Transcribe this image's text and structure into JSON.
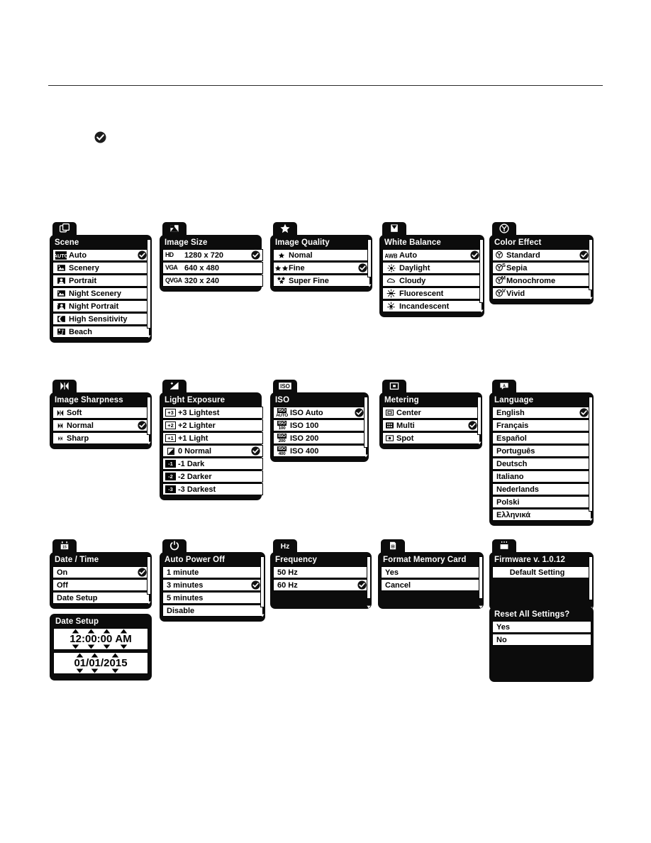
{
  "page": {
    "rule": true,
    "stray_check_icon": "check-circle-icon"
  },
  "menus": [
    {
      "id": "scene",
      "tab_icon": "scene-mode-icon",
      "title": "Scene",
      "scrollbar": true,
      "items": [
        {
          "icon": "auto-badge-icon",
          "label": "Auto",
          "selected": true
        },
        {
          "icon": "scenery-icon",
          "label": "Scenery",
          "selected": false
        },
        {
          "icon": "portrait-icon",
          "label": "Portrait",
          "selected": false
        },
        {
          "icon": "night-scenery-icon",
          "label": "Night Scenery",
          "selected": false
        },
        {
          "icon": "night-portrait-icon",
          "label": "Night Portrait",
          "selected": false
        },
        {
          "icon": "high-sensitivity-icon",
          "label": "High Sensitivity",
          "selected": false
        },
        {
          "icon": "beach-icon",
          "label": "Beach",
          "selected": false
        }
      ]
    },
    {
      "id": "image-size",
      "tab_icon": "image-size-icon",
      "title": "Image Size",
      "scrollbar": false,
      "items": [
        {
          "icon": "hd-badge-icon",
          "label": "1280 x 720",
          "badge": "HD",
          "selected": true
        },
        {
          "icon": "vga-badge-icon",
          "label": "640 x 480",
          "badge": "VGA",
          "selected": false
        },
        {
          "icon": "qvga-badge-icon",
          "label": "320 x 240",
          "badge": "QVGA",
          "selected": false
        }
      ]
    },
    {
      "id": "image-quality",
      "tab_icon": "star-icon",
      "title": "Image Quality",
      "scrollbar": true,
      "items": [
        {
          "icon": "one-star-icon",
          "label": "Nomal",
          "selected": false
        },
        {
          "icon": "two-star-icon",
          "label": "Fine",
          "selected": true
        },
        {
          "icon": "three-star-icon",
          "label": "Super Fine",
          "selected": false
        }
      ]
    },
    {
      "id": "white-balance",
      "tab_icon": "white-balance-icon",
      "title": "White Balance",
      "scrollbar": true,
      "items": [
        {
          "icon": "awb-badge-icon",
          "label": "Auto",
          "selected": true
        },
        {
          "icon": "sun-icon",
          "label": "Daylight",
          "selected": false
        },
        {
          "icon": "cloud-icon",
          "label": "Cloudy",
          "selected": false
        },
        {
          "icon": "fluorescent-icon",
          "label": "Fluorescent",
          "selected": false
        },
        {
          "icon": "incandescent-icon",
          "label": "Incandescent",
          "selected": false
        }
      ]
    },
    {
      "id": "color-effect",
      "tab_icon": "color-effect-icon",
      "title": "Color Effect",
      "scrollbar": true,
      "items": [
        {
          "icon": "color-standard-icon",
          "label": "Standard",
          "selected": true
        },
        {
          "icon": "color-sepia-icon",
          "label": "Sepia",
          "selected": false
        },
        {
          "icon": "color-monochrome-icon",
          "label": "Monochrome",
          "selected": false
        },
        {
          "icon": "color-vivid-icon",
          "label": "Vivid",
          "selected": false
        }
      ]
    },
    {
      "id": "image-sharpness",
      "tab_icon": "sharpness-icon",
      "title": "Image Sharpness",
      "scrollbar": true,
      "items": [
        {
          "icon": "sharp-soft-icon",
          "label": "Soft",
          "selected": false
        },
        {
          "icon": "sharp-normal-icon",
          "label": "Normal",
          "selected": true
        },
        {
          "icon": "sharp-sharp-icon",
          "label": "Sharp",
          "selected": false
        }
      ]
    },
    {
      "id": "light-exposure",
      "tab_icon": "exposure-icon",
      "title": "Light Exposure",
      "scrollbar": false,
      "items": [
        {
          "icon": "ev-plus3-icon",
          "label": "+3 Lightest",
          "badge": "+3",
          "selected": false
        },
        {
          "icon": "ev-plus2-icon",
          "label": "+2 Lighter",
          "badge": "+2",
          "selected": false
        },
        {
          "icon": "ev-plus1-icon",
          "label": "+1 Light",
          "badge": "+1",
          "selected": false
        },
        {
          "icon": "ev-zero-icon",
          "label": "0 Normal",
          "badge": "",
          "selected": true
        },
        {
          "icon": "ev-minus1-icon",
          "label": "-1 Dark",
          "badge": "-1",
          "selected": false
        },
        {
          "icon": "ev-minus2-icon",
          "label": "-2 Darker",
          "badge": "-2",
          "selected": false
        },
        {
          "icon": "ev-minus3-icon",
          "label": "-3 Darkest",
          "badge": "-3",
          "selected": false
        }
      ]
    },
    {
      "id": "iso",
      "tab_icon": "iso-icon",
      "title": "ISO",
      "scrollbar": true,
      "items": [
        {
          "icon": "iso-auto-badge-icon",
          "label": "ISO Auto",
          "badge": "AUTO",
          "selected": true
        },
        {
          "icon": "iso-100-badge-icon",
          "label": "ISO 100",
          "badge": "100",
          "selected": false
        },
        {
          "icon": "iso-200-badge-icon",
          "label": "ISO 200",
          "badge": "200",
          "selected": false
        },
        {
          "icon": "iso-400-badge-icon",
          "label": "ISO 400",
          "badge": "400",
          "selected": false
        }
      ]
    },
    {
      "id": "metering",
      "tab_icon": "metering-icon",
      "title": "Metering",
      "scrollbar": true,
      "items": [
        {
          "icon": "metering-center-icon",
          "label": "Center",
          "selected": false
        },
        {
          "icon": "metering-multi-icon",
          "label": "Multi",
          "selected": true
        },
        {
          "icon": "metering-spot-icon",
          "label": "Spot",
          "selected": false
        }
      ]
    },
    {
      "id": "language",
      "tab_icon": "language-icon",
      "title": "Language",
      "scrollbar": true,
      "items": [
        {
          "icon": "",
          "label": "English",
          "selected": true
        },
        {
          "icon": "",
          "label": "Français",
          "selected": false
        },
        {
          "icon": "",
          "label": "Español",
          "selected": false
        },
        {
          "icon": "",
          "label": "Português",
          "selected": false
        },
        {
          "icon": "",
          "label": "Deutsch",
          "selected": false
        },
        {
          "icon": "",
          "label": "Italiano",
          "selected": false
        },
        {
          "icon": "",
          "label": "Nederlands",
          "selected": false
        },
        {
          "icon": "",
          "label": "Polski",
          "selected": false
        },
        {
          "icon": "",
          "label": "Ελληνικά",
          "selected": false
        }
      ]
    },
    {
      "id": "date-time",
      "tab_icon": "calendar-icon",
      "title": "Date / Time",
      "scrollbar": true,
      "items": [
        {
          "icon": "",
          "label": "On",
          "selected": true
        },
        {
          "icon": "",
          "label": "Off",
          "selected": false
        },
        {
          "icon": "",
          "label": "Date Setup",
          "selected": false
        }
      ]
    },
    {
      "id": "auto-power-off",
      "tab_icon": "power-icon",
      "title": "Auto Power Off",
      "scrollbar": true,
      "items": [
        {
          "icon": "",
          "label": "1 minute",
          "selected": false
        },
        {
          "icon": "",
          "label": "3 minutes",
          "selected": true
        },
        {
          "icon": "",
          "label": "5 minutes",
          "selected": false
        },
        {
          "icon": "",
          "label": "Disable",
          "selected": false
        }
      ]
    },
    {
      "id": "frequency",
      "tab_icon": "hz-icon",
      "title": "Frequency",
      "scrollbar": true,
      "items": [
        {
          "icon": "",
          "label": "50 Hz",
          "selected": false
        },
        {
          "icon": "",
          "label": "60 Hz",
          "selected": true
        }
      ]
    },
    {
      "id": "format-memory-card",
      "tab_icon": "memory-card-icon",
      "title": "Format Memory Card",
      "scrollbar": true,
      "items": [
        {
          "icon": "",
          "label": "Yes",
          "selected": false
        },
        {
          "icon": "",
          "label": "Cancel",
          "selected": false
        }
      ]
    },
    {
      "id": "firmware",
      "tab_icon": "firmware-icon",
      "title": "Firmware v. 1.0.12",
      "scrollbar": true,
      "items": [
        {
          "icon": "",
          "label": "Default Setting",
          "selected": false,
          "center": true
        }
      ]
    },
    {
      "id": "reset-all-settings",
      "tab_icon": "",
      "title": "Reset All Settings?",
      "scrollbar": false,
      "items": [
        {
          "icon": "",
          "label": "Yes",
          "selected": false
        },
        {
          "icon": "",
          "label": "No",
          "selected": false
        }
      ]
    }
  ],
  "date_setup": {
    "title": "Date Setup",
    "time": {
      "hour": "12",
      "minute": "00",
      "second": "00",
      "meridiem": "AM",
      "separator": ":"
    },
    "date": {
      "month": "01",
      "day": "01",
      "year": "2015",
      "separator": "/"
    }
  }
}
